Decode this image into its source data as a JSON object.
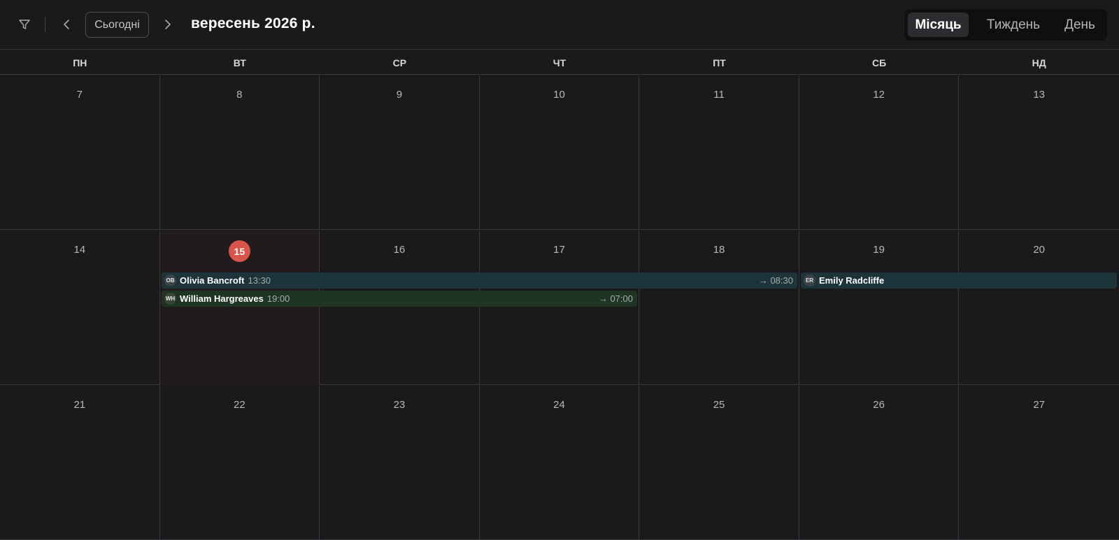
{
  "toolbar": {
    "today_label": "Сьогодні",
    "month_title": "вересень 2026 р.",
    "views": {
      "month": "Місяць",
      "week": "Тиждень",
      "day": "День",
      "active": "month"
    }
  },
  "weekdays": [
    "ПН",
    "ВТ",
    "СР",
    "ЧТ",
    "ПТ",
    "СБ",
    "НД"
  ],
  "weeks": [
    [
      "7",
      "8",
      "9",
      "10",
      "11",
      "12",
      "13"
    ],
    [
      "14",
      "15",
      "16",
      "17",
      "18",
      "19",
      "20"
    ],
    [
      "21",
      "22",
      "23",
      "24",
      "25",
      "26",
      "27"
    ]
  ],
  "today": "15",
  "events": [
    {
      "initials": "OB",
      "name": "Olivia Bancroft",
      "start": "13:30",
      "end": "→ 08:30",
      "color": "#1d343b"
    },
    {
      "initials": "WH",
      "name": "William Hargreaves",
      "start": "19:00",
      "end": "→ 07:00",
      "color": "#1f3524"
    },
    {
      "initials": "ER",
      "name": "Emily Radcliffe",
      "start": "",
      "end": "",
      "color": "#1d343b"
    }
  ],
  "colors": {
    "background": "#1a1a1c",
    "today_badge": "#d9544a",
    "today_cell": "#211b1d"
  }
}
